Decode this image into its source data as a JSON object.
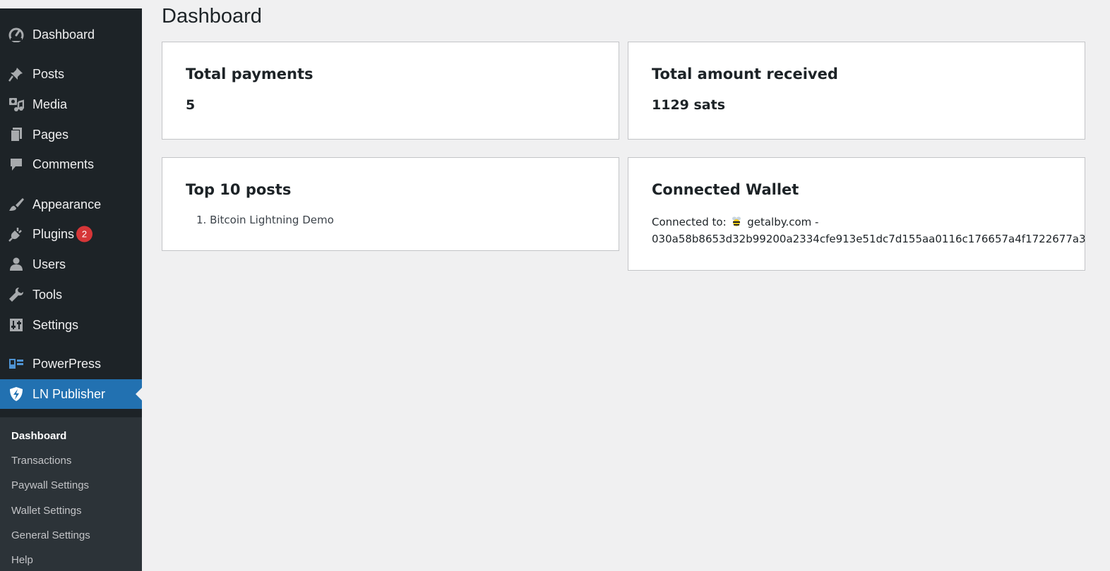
{
  "sidebar": {
    "items": [
      {
        "label": "Dashboard",
        "icon": "dashboard-icon"
      },
      {
        "label": "Posts",
        "icon": "pin-icon"
      },
      {
        "label": "Media",
        "icon": "media-icon"
      },
      {
        "label": "Pages",
        "icon": "pages-icon"
      },
      {
        "label": "Comments",
        "icon": "comment-icon"
      },
      {
        "label": "Appearance",
        "icon": "brush-icon"
      },
      {
        "label": "Plugins",
        "icon": "plug-icon",
        "badge": "2"
      },
      {
        "label": "Users",
        "icon": "user-icon"
      },
      {
        "label": "Tools",
        "icon": "wrench-icon"
      },
      {
        "label": "Settings",
        "icon": "sliders-icon"
      },
      {
        "label": "PowerPress",
        "icon": "powerpress-icon"
      },
      {
        "label": "LN Publisher",
        "icon": "lightning-shield-icon",
        "active": true
      }
    ],
    "submenu": [
      {
        "label": "Dashboard",
        "current": true
      },
      {
        "label": "Transactions"
      },
      {
        "label": "Paywall Settings"
      },
      {
        "label": "Wallet Settings"
      },
      {
        "label": "General Settings"
      },
      {
        "label": "Help"
      }
    ]
  },
  "page": {
    "title": "Dashboard"
  },
  "cards": {
    "total_payments": {
      "title": "Total payments",
      "value": "5"
    },
    "total_amount": {
      "title": "Total amount received",
      "value": "1129 sats"
    },
    "top_posts": {
      "title": "Top 10 posts",
      "items": [
        "Bitcoin Lightning Demo"
      ]
    },
    "wallet": {
      "title": "Connected Wallet",
      "prefix": "Connected to:",
      "provider": "getalby.com -",
      "node_id": "030a58b8653d32b99200a2334cfe913e51dc7d155aa0116c176657a4f1722677a3",
      "provider_icon": "bee-icon"
    }
  },
  "colors": {
    "sidebar_bg": "#1d2327",
    "submenu_bg": "#2c3338",
    "accent": "#2271b1",
    "badge": "#d63638",
    "page_bg": "#f0f0f1"
  }
}
